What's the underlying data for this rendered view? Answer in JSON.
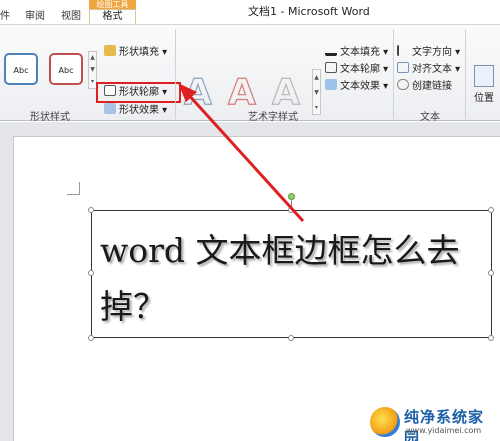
{
  "titlebar": {
    "drawing_tools": "绘图工具",
    "tabs": [
      "件",
      "审阅",
      "视图"
    ],
    "format_tab": "格式",
    "doc_title": "文档1 - Microsoft Word"
  },
  "ribbon": {
    "shape_styles": {
      "label": "形状样式",
      "style_samples": [
        "Abc",
        "Abc"
      ],
      "commands": [
        "形状填充",
        "形状轮廓",
        "形状效果"
      ]
    },
    "wordart_styles": {
      "label": "艺术字样式",
      "samples": [
        "A",
        "A",
        "A"
      ],
      "commands": [
        "文本填充",
        "文本轮廓",
        "文本效果"
      ]
    },
    "text": {
      "label": "文本",
      "commands": [
        "文字方向",
        "对齐文本",
        "创建链接"
      ]
    },
    "position": {
      "label": "位置"
    }
  },
  "document": {
    "textbox_text": "word 文本框边框怎么去掉？"
  },
  "watermark": {
    "brand": "纯净系统家园",
    "url": "www.yidaimei.com"
  },
  "colors": {
    "highlight": "#e02020",
    "drawing_tools_tab": "#f0a640",
    "accent_blue": "#4f81bd"
  }
}
